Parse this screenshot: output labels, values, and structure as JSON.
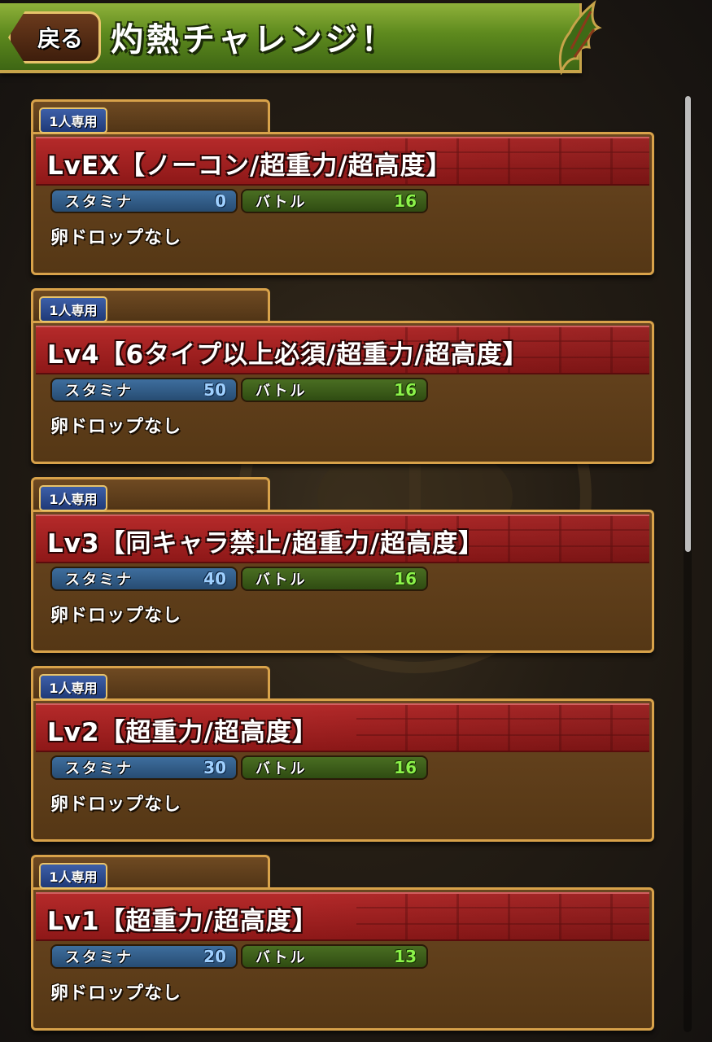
{
  "header": {
    "back_label": "戻る",
    "title": "灼熱チャレンジ！"
  },
  "dungeons": [
    {
      "badge": "1人専用",
      "name": "LvEX【ノーコン/超重力/超高度】",
      "stamina_label": "スタミナ",
      "stamina": "0",
      "battle_label": "バトル",
      "battles": "16",
      "drop": "卵ドロップなし"
    },
    {
      "badge": "1人専用",
      "name": "Lv4【6タイプ以上必須/超重力/超高度】",
      "stamina_label": "スタミナ",
      "stamina": "50",
      "battle_label": "バトル",
      "battles": "16",
      "drop": "卵ドロップなし"
    },
    {
      "badge": "1人専用",
      "name": "Lv3【同キャラ禁止/超重力/超高度】",
      "stamina_label": "スタミナ",
      "stamina": "40",
      "battle_label": "バトル",
      "battles": "16",
      "drop": "卵ドロップなし"
    },
    {
      "badge": "1人専用",
      "name": "Lv2【超重力/超高度】",
      "stamina_label": "スタミナ",
      "stamina": "30",
      "battle_label": "バトル",
      "battles": "16",
      "drop": "卵ドロップなし"
    },
    {
      "badge": "1人専用",
      "name": "Lv1【超重力/超高度】",
      "stamina_label": "スタミナ",
      "stamina": "20",
      "battle_label": "バトル",
      "battles": "13",
      "drop": "卵ドロップなし"
    }
  ],
  "colors": {
    "header_green": "#5e8a1e",
    "card_brown": "#553715",
    "name_red": "#8e1818",
    "gold_border": "#d8a24a",
    "stamina_value": "#9fd0ff",
    "battle_value": "#8cf24a"
  },
  "icons": {
    "header_ornament": "dragon-wing-icon"
  }
}
